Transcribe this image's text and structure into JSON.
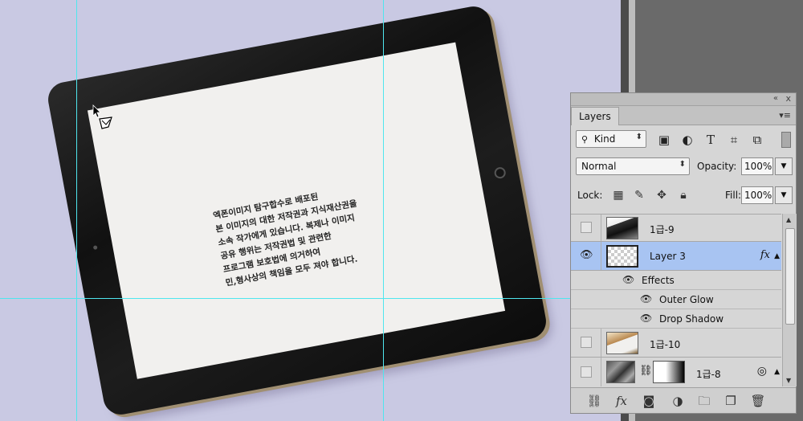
{
  "canvas": {
    "screen_text_lines": [
      "엑폰이미지 탐구합수로 배포된",
      "본 이미지의 대한 저작권과 지식재산권을",
      "소속 작가에게 있습니다. 복제나 이미지",
      "공유 행위는 저작권법 및 관련한",
      "프로그램 보호법에 의거하여",
      "민,형사상의 책임을 모두 져야 합니다."
    ]
  },
  "layers_panel": {
    "tab_label": "Layers",
    "collapse_icon": "«",
    "close_icon": "x",
    "menu_icon": "▾≡",
    "filter": {
      "kind_label": "Kind",
      "icons": [
        "image-filter-icon",
        "adjustment-filter-icon",
        "type-filter-icon",
        "shape-filter-icon",
        "smart-object-filter-icon"
      ],
      "type_glyph": "T"
    },
    "blend": {
      "mode": "Normal",
      "opacity_label": "Opacity:",
      "opacity_value": "100%"
    },
    "lock": {
      "label": "Lock:",
      "fill_label": "Fill:",
      "fill_value": "100%"
    },
    "layers": [
      {
        "name": "1급-9",
        "visible": false,
        "selected": false
      },
      {
        "name": "Layer 3",
        "visible": true,
        "selected": true,
        "fx": "fx"
      },
      {
        "name": "1급-10",
        "visible": false,
        "selected": false
      },
      {
        "name": "1급-8",
        "visible": false,
        "selected": false
      }
    ],
    "effects": {
      "header": "Effects",
      "items": [
        "Outer Glow",
        "Drop Shadow"
      ]
    },
    "bottom_icons": [
      "link-layers-icon",
      "add-style-icon",
      "add-mask-icon",
      "new-adjustment-icon",
      "new-group-icon",
      "new-layer-icon",
      "delete-layer-icon"
    ],
    "fx_glyph": "fx"
  },
  "colors": {
    "canvas_bg": "#c9c9e3",
    "guide": "#4fe6ee",
    "selected_row": "#a8c4f2"
  }
}
